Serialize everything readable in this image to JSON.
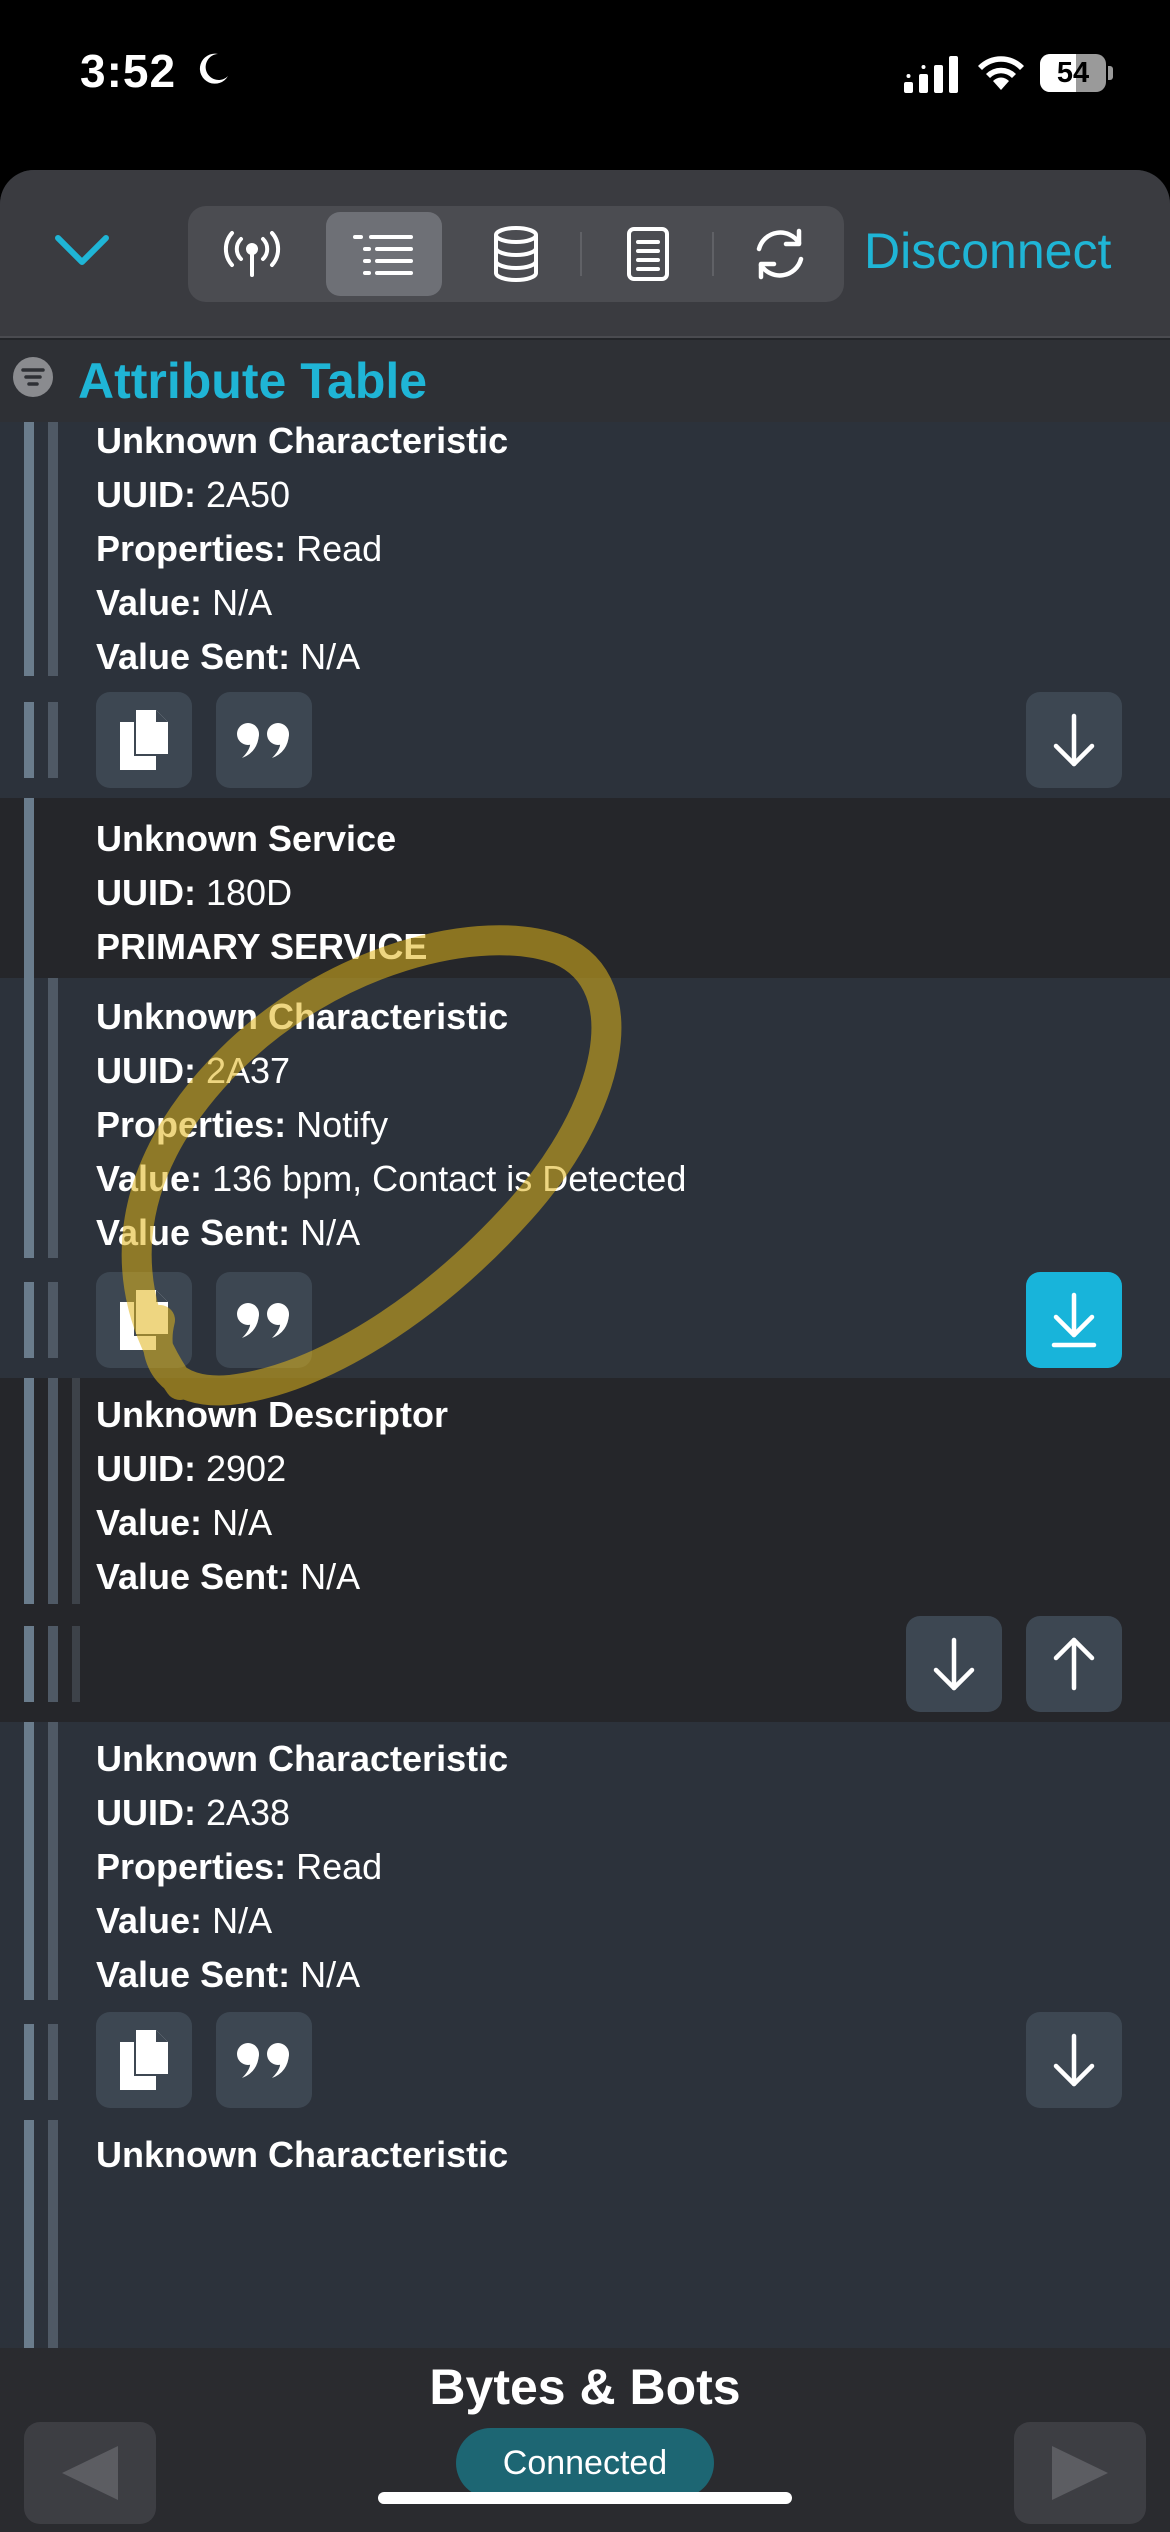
{
  "status_bar": {
    "time": "3:52",
    "battery": "54",
    "battery_level": 0.54
  },
  "toolbar": {
    "collapse_icon": "chevron-down-icon",
    "segments": [
      {
        "icon": "antenna-icon",
        "active": false
      },
      {
        "icon": "list-icon",
        "active": true
      },
      {
        "icon": "database-icon",
        "active": false
      },
      {
        "icon": "document-icon",
        "active": false
      },
      {
        "icon": "refresh-icon",
        "active": false
      }
    ],
    "disconnect_label": "Disconnect"
  },
  "section": {
    "title": "Attribute Table"
  },
  "labels": {
    "uuid": "UUID:",
    "properties": "Properties:",
    "value": "Value:",
    "value_sent": "Value Sent:"
  },
  "rows": [
    {
      "kind": "characteristic",
      "name": "Unknown Characteristic",
      "uuid": "2A50",
      "properties": "Read",
      "value": "N/A",
      "value_sent": "N/A"
    },
    {
      "kind": "service",
      "name": "Unknown Service",
      "uuid": "180D",
      "type": "PRIMARY SERVICE"
    },
    {
      "kind": "characteristic",
      "name": "Unknown Characteristic",
      "uuid": "2A37",
      "properties": "Notify",
      "value": "136 bpm, Contact is Detected",
      "value_sent": "N/A",
      "notify_active": true
    },
    {
      "kind": "descriptor",
      "name": "Unknown Descriptor",
      "uuid": "2902",
      "value": "N/A",
      "value_sent": "N/A"
    },
    {
      "kind": "characteristic",
      "name": "Unknown Characteristic",
      "uuid": "2A38",
      "properties": "Read",
      "value": "N/A",
      "value_sent": "N/A"
    },
    {
      "kind": "characteristic",
      "name": "Unknown Characteristic"
    }
  ],
  "footer": {
    "device_name": "Bytes & Bots",
    "status": "Connected"
  },
  "colors": {
    "accent": "#1fb5d6",
    "status_badge": "#1d6673",
    "highlight_button": "#18b4da",
    "annotation": "#e0b41a"
  }
}
